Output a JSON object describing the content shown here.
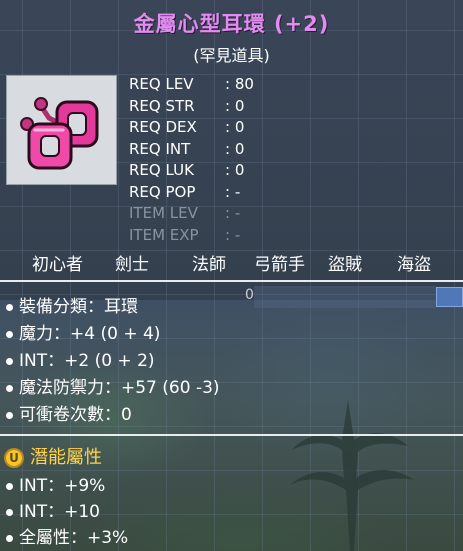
{
  "item": {
    "name": "金屬心型耳環 (+2)",
    "rarity": "(罕見道具)",
    "name_color": "#e08cf0"
  },
  "requirements": [
    {
      "label": "REQ LEV",
      "value": ": 80"
    },
    {
      "label": "REQ STR",
      "value": ": 0"
    },
    {
      "label": "REQ DEX",
      "value": ": 0"
    },
    {
      "label": "REQ INT",
      "value": ": 0"
    },
    {
      "label": "REQ LUK",
      "value": ": 0"
    },
    {
      "label": "REQ POP",
      "value": ": -"
    },
    {
      "label": "ITEM LEV",
      "value": ": -"
    },
    {
      "label": "ITEM EXP",
      "value": ": -"
    }
  ],
  "jobs": [
    "初心者",
    "劍士",
    "法師",
    "弓箭手",
    "盜賊",
    "海盜"
  ],
  "slot_count": "0",
  "stats": [
    "裝備分類：耳環",
    "魔力：+4 (0 + 4)",
    "INT：+2 (0 + 2)",
    "魔法防禦力：+57 (60 -3)",
    "可衝卷次數：0"
  ],
  "potential": {
    "badge": "U",
    "title": "潛能屬性",
    "title_color": "#ffd34a",
    "lines": [
      "INT：+9%",
      "INT：+10",
      "全屬性：+3%"
    ]
  },
  "icons": {
    "item": "pink-heart-earring-icon",
    "potential_badge": "unique-potential-icon"
  }
}
